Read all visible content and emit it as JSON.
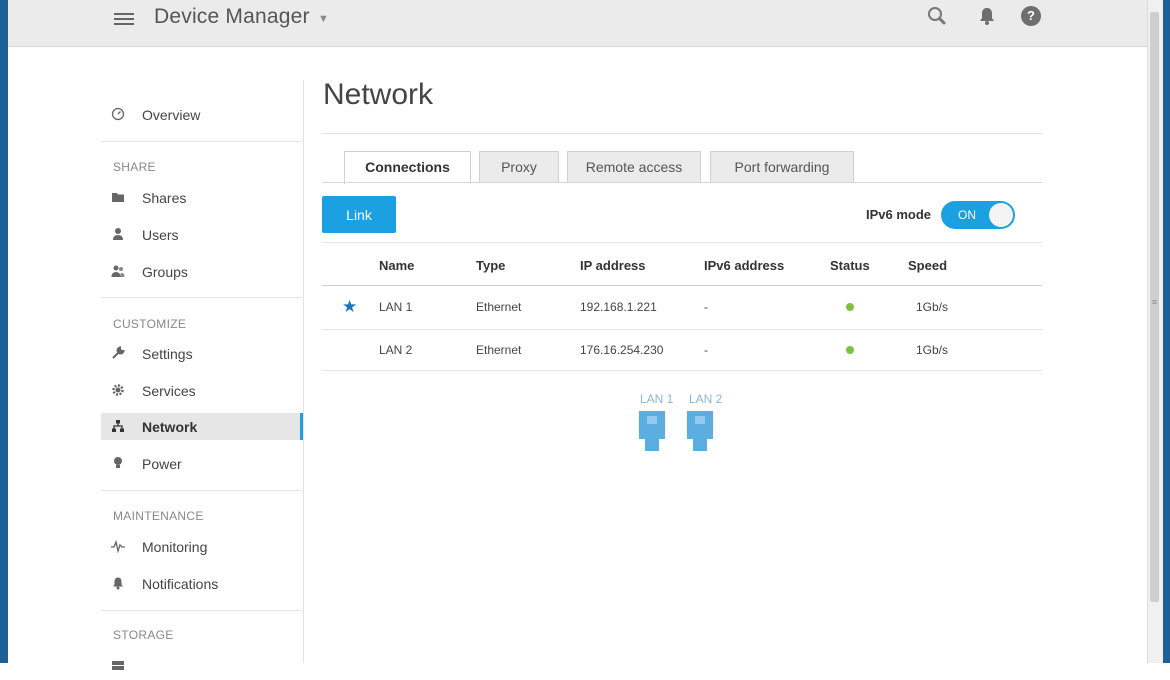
{
  "app": {
    "title": "Device Manager"
  },
  "sidebar": {
    "overview": "Overview",
    "sections": {
      "share": "SHARE",
      "customize": "CUSTOMIZE",
      "maintenance": "MAINTENANCE",
      "storage": "STORAGE"
    },
    "items": {
      "shares": "Shares",
      "users": "Users",
      "groups": "Groups",
      "settings": "Settings",
      "services": "Services",
      "network": "Network",
      "power": "Power",
      "monitoring": "Monitoring",
      "notifications": "Notifications"
    },
    "active": "Network"
  },
  "main": {
    "title": "Network",
    "tabs": [
      "Connections",
      "Proxy",
      "Remote access",
      "Port forwarding"
    ],
    "active_tab": "Connections",
    "link_button": "Link",
    "ipv6": {
      "label": "IPv6 mode",
      "state": "ON"
    },
    "table": {
      "columns": [
        "Name",
        "Type",
        "IP address",
        "IPv6 address",
        "Status",
        "Speed"
      ],
      "rows": [
        {
          "primary": true,
          "name": "LAN 1",
          "type": "Ethernet",
          "ip": "192.168.1.221",
          "ipv6": "-",
          "status": "connected",
          "speed": "1Gb/s"
        },
        {
          "primary": false,
          "name": "LAN 2",
          "type": "Ethernet",
          "ip": "176.16.254.230",
          "ipv6": "-",
          "status": "connected",
          "speed": "1Gb/s"
        }
      ]
    },
    "ports": [
      "LAN 1",
      "LAN 2"
    ]
  },
  "colors": {
    "accent": "#1ba1e2",
    "status_ok": "#7cc242",
    "port": "#5aaee0",
    "star": "#1b75bc"
  },
  "icons": [
    "menu-icon",
    "search-icon",
    "bell-icon",
    "help-icon",
    "overview-icon",
    "folder-icon",
    "user-icon",
    "group-icon",
    "wrench-icon",
    "gear-icon",
    "network-icon",
    "bulb-icon",
    "pulse-icon",
    "bell-icon",
    "star-icon",
    "ethernet-port-icon"
  ]
}
